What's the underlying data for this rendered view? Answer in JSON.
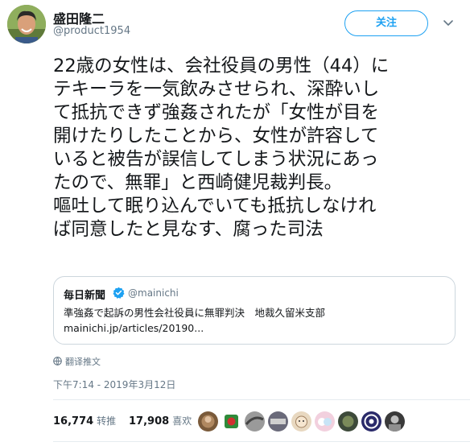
{
  "author": {
    "name": "盛田隆二",
    "handle": "@product1954"
  },
  "follow_button": {
    "label": "关注"
  },
  "tweet_lines": [
    "22歳の女性は、会社役員の男性（44）に",
    "テキーラを一気飲みさせられ、深酔いし",
    "て抵抗できず強姦されたが「女性が目を",
    "開けたりしたことから、女性が許容して",
    "いると被告が誤信してしまう状況にあっ",
    "たので、無罪」と西崎健児裁判長。",
    "嘔吐して眠り込んでいても抵抗しなけれ",
    "ば同意したと見なす、腐った司法"
  ],
  "quote": {
    "name": "毎日新聞",
    "handle": "@mainichi",
    "text": "準強姦で起訴の男性会社役員に無罪判決　地裁久留米支部",
    "link": "mainichi.jp/articles/20190..."
  },
  "translate_label": "翻译推文",
  "timestamp": "下午7:14 - 2019年3月12日",
  "stats": {
    "retweets_count": "16,774",
    "retweets_label": "转推",
    "likes_count": "17,908",
    "likes_label": "喜欢"
  },
  "colors": {
    "accent": "#1da1f2",
    "secondary_text": "#657786",
    "border": "#ccd6dd"
  }
}
